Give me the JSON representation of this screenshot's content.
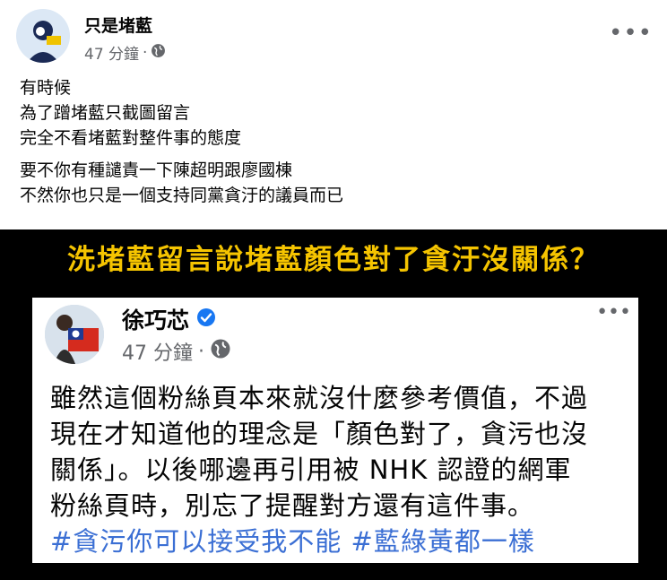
{
  "post": {
    "author": "只是堵藍",
    "time": "47 分鐘",
    "separator": "·",
    "body": {
      "lines1": [
        "有時候",
        "為了蹭堵藍只截圖留言",
        "完全不看堵藍對整件事的態度"
      ],
      "lines2": [
        "要不你有種譴責一下陳超明跟廖國棟",
        "不然你也只是一個支持同黨貪汙的議員而已"
      ]
    }
  },
  "image": {
    "banner": "洗堵藍留言說堵藍顏色對了貪汙沒關係？",
    "inner_post": {
      "author": "徐巧芯",
      "time": "47 分鐘",
      "separator": "·",
      "lines": [
        "雖然這個粉絲頁本來就沒什麼參考價值，不過",
        "現在才知道他的理念是「顏色對了，貪污也沒",
        "關係」。以後哪邊再引用被 NHK 認證的網軍",
        "粉絲頁時，別忘了提醒對方還有這件事。"
      ],
      "hashtags": "#貪污你可以接受我不能 #藍綠黃都一樣"
    }
  },
  "colors": {
    "banner": "#f5c400",
    "hashtag": "#3b6fd4",
    "meta": "#65676b",
    "verified": "#1877f2"
  },
  "icons": [
    "globe-icon",
    "more-options-icon",
    "verified-badge-icon"
  ]
}
